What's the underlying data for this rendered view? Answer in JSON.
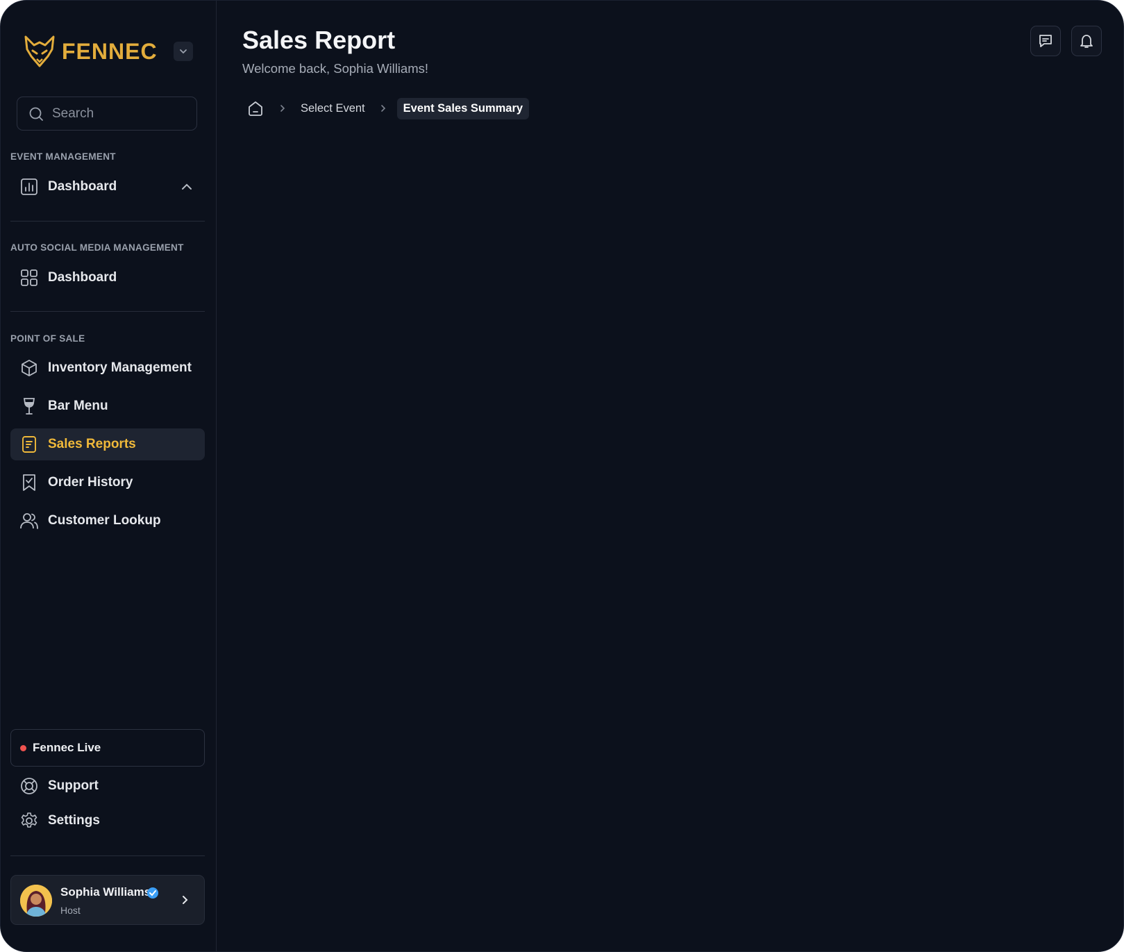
{
  "brand": {
    "name": "FENNEC"
  },
  "search": {
    "placeholder": "Search"
  },
  "sections": {
    "event_management": "EVENT MANAGEMENT",
    "social_media": "AUTO SOCIAL MEDIA MANAGEMENT",
    "point_of_sale": "POINT OF SALE"
  },
  "nav": {
    "event_dashboard": "Dashboard",
    "social_dashboard": "Dashboard",
    "inventory": "Inventory Management",
    "bar_menu": "Bar Menu",
    "sales_reports": "Sales Reports",
    "order_history": "Order History",
    "customer_lookup": "Customer Lookup"
  },
  "footer": {
    "live": "Fennec Live",
    "support": "Support",
    "settings": "Settings"
  },
  "user": {
    "name": "Sophia Williams",
    "role": "Host"
  },
  "header": {
    "title": "Sales Report",
    "subtitle": "Welcome back, Sophia Williams!"
  },
  "breadcrumb": {
    "items": [
      "Select Event",
      "Event Sales Summary"
    ]
  },
  "colors": {
    "background": "#0c111c",
    "accent": "#f0b93a",
    "live": "#ef5350",
    "verified": "#3b9ef5"
  },
  "icons": {
    "logo": "fox-logo-icon",
    "search": "search-icon",
    "event_dashboard": "bar-chart-icon",
    "social_dashboard": "grid-icon",
    "inventory": "box-icon",
    "bar_menu": "wine-glass-icon",
    "sales_reports": "report-icon",
    "order_history": "bookmark-check-icon",
    "customer_lookup": "users-icon",
    "support": "lifebuoy-icon",
    "settings": "gear-icon",
    "messages": "message-icon",
    "notifications": "bell-icon",
    "home": "home-icon"
  }
}
